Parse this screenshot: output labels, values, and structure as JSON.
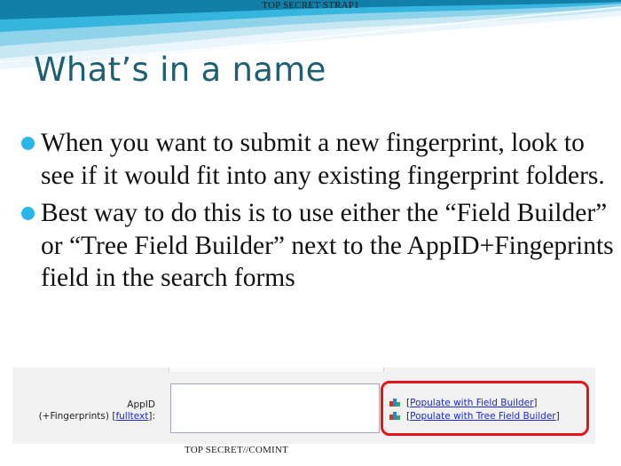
{
  "header": {
    "classification_top": "TOP SECRET STRAP1"
  },
  "slide": {
    "title": "What’s in a name",
    "bullets": [
      "When you want to submit a new fingerprint, look to see if it would fit into any existing fingerprint folders.",
      "Best way to do this is to use either the “Field Builder” or “Tree Field Builder” next to the AppID+Fingeprints field in the search forms"
    ]
  },
  "screenshot": {
    "field_label_line1": "AppID",
    "field_label_line2": "(+Fingerprints)",
    "fulltext_bracket_open": "[",
    "fulltext_link": "fulltext",
    "fulltext_bracket_close": "]:",
    "field_value": "",
    "builders": [
      {
        "open": "[",
        "label": "Populate with Field Builder",
        "close": "]"
      },
      {
        "open": "[",
        "label": "Populate with Tree Field Builder",
        "close": "]"
      }
    ]
  },
  "footer": {
    "classification_bottom": "TOP SECRET//COMINT"
  },
  "colors": {
    "title": "#1f5f73",
    "bullet": "#28b7e6",
    "highlight": "#e3141c",
    "link": "#1a2acb"
  }
}
